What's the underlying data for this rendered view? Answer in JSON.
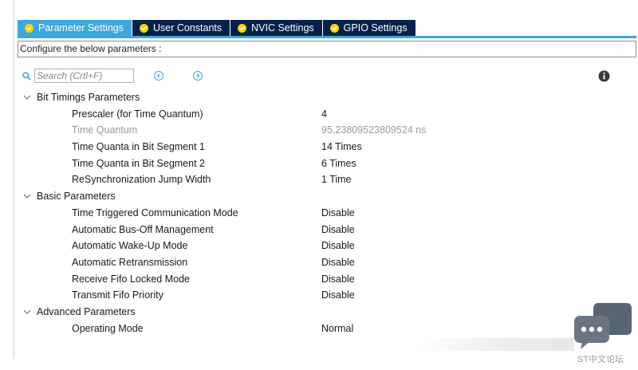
{
  "tabs": [
    {
      "label": "Parameter Settings",
      "active": true
    },
    {
      "label": "User Constants",
      "active": false
    },
    {
      "label": "NVIC Settings",
      "active": false
    },
    {
      "label": "GPIO Settings",
      "active": false
    }
  ],
  "config_text": "Configure the below parameters :",
  "search": {
    "placeholder": "Search (Crtl+F)",
    "value": ""
  },
  "groups": [
    {
      "label": "Bit Timings Parameters",
      "params": [
        {
          "name": "Prescaler (for Time Quantum)",
          "value": "4",
          "disabled": false
        },
        {
          "name": "Time Quantum",
          "value": "95.23809523809524 ns",
          "disabled": true
        },
        {
          "name": "Time Quanta in Bit Segment 1",
          "value": "14 Times",
          "disabled": false
        },
        {
          "name": "Time Quanta in Bit Segment 2",
          "value": "6 Times",
          "disabled": false
        },
        {
          "name": "ReSynchronization Jump Width",
          "value": "1 Time",
          "disabled": false
        }
      ]
    },
    {
      "label": "Basic Parameters",
      "params": [
        {
          "name": "Time Triggered Communication Mode",
          "value": "Disable",
          "disabled": false
        },
        {
          "name": "Automatic Bus-Off Management",
          "value": "Disable",
          "disabled": false
        },
        {
          "name": "Automatic Wake-Up Mode",
          "value": "Disable",
          "disabled": false
        },
        {
          "name": "Automatic Retransmission",
          "value": "Disable",
          "disabled": false
        },
        {
          "name": "Receive Fifo Locked Mode",
          "value": "Disable",
          "disabled": false
        },
        {
          "name": "Transmit Fifo Priority",
          "value": "Disable",
          "disabled": false
        }
      ]
    },
    {
      "label": "Advanced Parameters",
      "params": [
        {
          "name": "Operating Mode",
          "value": "Normal",
          "disabled": false
        }
      ]
    }
  ],
  "watermark": {
    "text": "ST中文论坛"
  },
  "colors": {
    "tab_active": "#3ca7dc",
    "tab_inactive": "#03234b",
    "check": "#ffd200",
    "disabled_text": "#9a9a9a"
  },
  "icons": {
    "search": "search-icon",
    "info": "info-icon",
    "prev": "previous-arrow-icon",
    "next": "next-arrow-icon",
    "expand": "chevron-down-icon",
    "check": "check-circle-icon"
  }
}
